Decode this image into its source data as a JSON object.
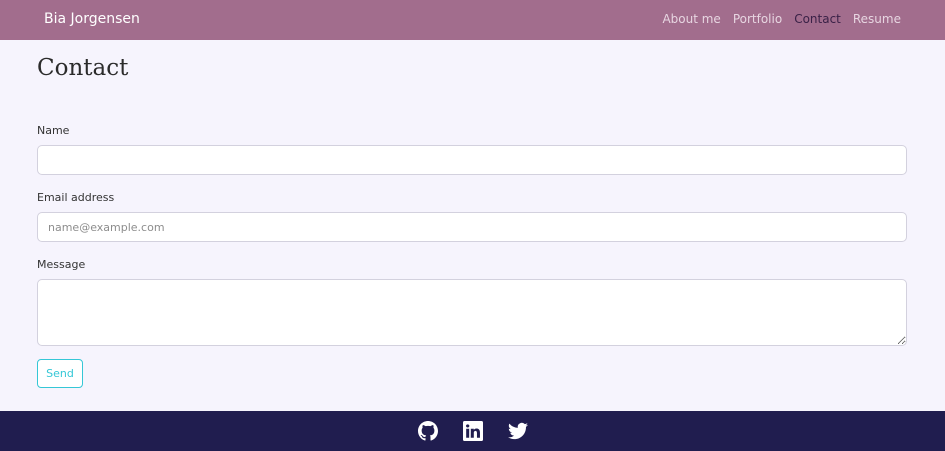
{
  "navbar": {
    "brand": "Bia Jorgensen",
    "links": [
      {
        "label": "About me",
        "active": false
      },
      {
        "label": "Portfolio",
        "active": false
      },
      {
        "label": "Contact",
        "active": true
      },
      {
        "label": "Resume",
        "active": false
      }
    ]
  },
  "page": {
    "title": "Contact"
  },
  "form": {
    "name_label": "Name",
    "name_value": "",
    "email_label": "Email address",
    "email_placeholder": "name@example.com",
    "message_label": "Message",
    "message_value": "",
    "send_label": "Send"
  },
  "footer": {
    "icons": [
      "github-icon",
      "linkedin-icon",
      "twitter-icon"
    ]
  },
  "colors": {
    "navbar_bg": "#a26d8d",
    "page_bg": "#f6f4fd",
    "footer_bg": "#201d4f",
    "accent": "#35c7d6",
    "active_link": "#3a2147"
  }
}
